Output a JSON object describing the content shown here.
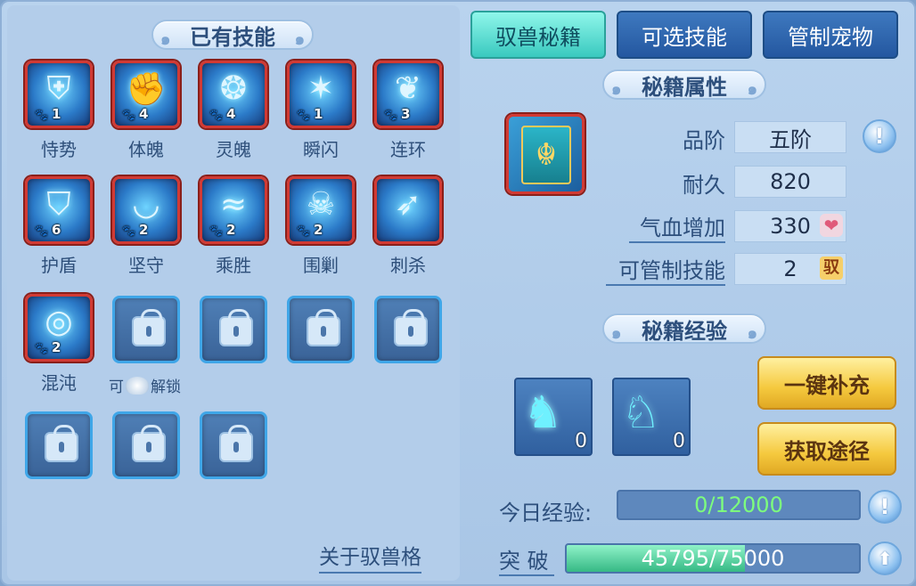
{
  "left": {
    "title": "已有技能",
    "skills": [
      {
        "name": "恃势",
        "count": "1",
        "glyph": "⛨",
        "icon": "claw-armor-icon"
      },
      {
        "name": "体魄",
        "count": "4",
        "glyph": "✊",
        "icon": "golden-beast-icon"
      },
      {
        "name": "灵魄",
        "count": "4",
        "glyph": "❂",
        "icon": "spirit-beast-icon"
      },
      {
        "name": "瞬闪",
        "count": "1",
        "glyph": "✶",
        "icon": "flash-icon"
      },
      {
        "name": "连环",
        "count": "3",
        "glyph": "❦",
        "icon": "chain-claw-icon"
      },
      {
        "name": "护盾",
        "count": "6",
        "glyph": "⛉",
        "icon": "shield-icon"
      },
      {
        "name": "坚守",
        "count": "2",
        "glyph": "◡",
        "icon": "guard-icon"
      },
      {
        "name": "乘胜",
        "count": "2",
        "glyph": "≈",
        "icon": "victory-wave-icon"
      },
      {
        "name": "围剿",
        "count": "2",
        "glyph": "☠",
        "icon": "tiger-icon"
      },
      {
        "name": "刺杀",
        "count": "",
        "glyph": "➶",
        "icon": "assassin-icon"
      },
      {
        "name": "混沌",
        "count": "2",
        "glyph": "◎",
        "icon": "chaos-bubble-icon"
      }
    ],
    "unlock_hint": {
      "prefix": "可",
      "suffix": "解锁"
    },
    "about_link": "关于驭兽格"
  },
  "tabs": [
    {
      "label": "驭兽秘籍",
      "active": true
    },
    {
      "label": "可选技能",
      "active": false
    },
    {
      "label": "管制宠物",
      "active": false
    }
  ],
  "attributes": {
    "title": "秘籍属性",
    "rows": [
      {
        "label": "品阶",
        "value": "五阶"
      },
      {
        "label": "耐久",
        "value": "820"
      },
      {
        "label": "气血增加",
        "value": "330"
      },
      {
        "label": "可管制技能",
        "value": "2",
        "tag": "驭"
      }
    ],
    "info_button": "!"
  },
  "experience": {
    "title": "秘籍经验",
    "items": [
      {
        "count": "0",
        "icon": "spirit-horse-icon"
      },
      {
        "count": "0",
        "icon": "spirit-horse-head-icon"
      }
    ],
    "refill_button": "一键补充",
    "acquire_button": "获取途径",
    "today_label": "今日经验:",
    "today_value": "0/12000",
    "today_progress": 0,
    "break_label": "突 破",
    "break_value": "45795/75000",
    "break_progress": 0.6106
  },
  "colors": {
    "tab_active": "#39c9bf",
    "heart_tag": "#e05a7a",
    "green_text": "#7dff7d"
  }
}
